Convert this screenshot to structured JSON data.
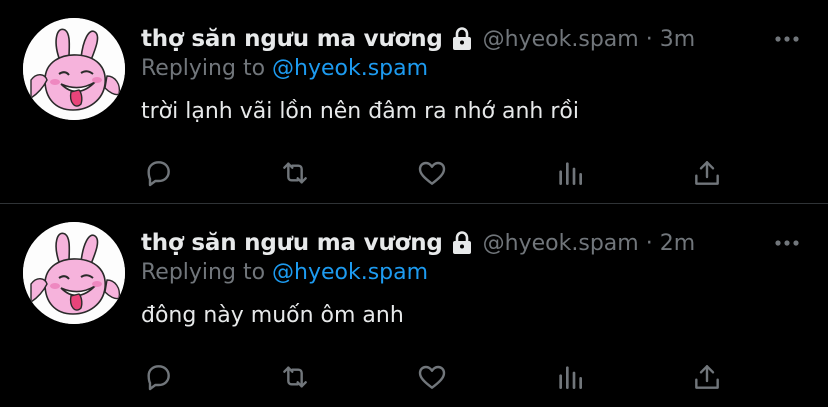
{
  "colors": {
    "background": "#000000",
    "primary_text": "#e7e9ea",
    "secondary_text": "#71767b",
    "link": "#1d9bf0",
    "divider": "#2f3336"
  },
  "tweets": [
    {
      "display_name": "thợ săn ngưu ma vương",
      "handle": "@hyeok.spam",
      "separator": "·",
      "time": "3m",
      "replying_to_label": "Replying to",
      "replying_to_handle": "@hyeok.spam",
      "text": "trời lạnh vãi lồn nên đâm ra nhớ anh rồi",
      "icons": [
        "lock-icon",
        "more-icon",
        "reply-icon",
        "retweet-icon",
        "like-icon",
        "analytics-icon",
        "share-icon"
      ]
    },
    {
      "display_name": "thợ săn ngưu ma vương",
      "handle": "@hyeok.spam",
      "separator": "·",
      "time": "2m",
      "replying_to_label": "Replying to",
      "replying_to_handle": "@hyeok.spam",
      "text": "đông này muốn ôm anh",
      "icons": [
        "lock-icon",
        "more-icon",
        "reply-icon",
        "retweet-icon",
        "like-icon",
        "analytics-icon",
        "share-icon"
      ]
    }
  ]
}
